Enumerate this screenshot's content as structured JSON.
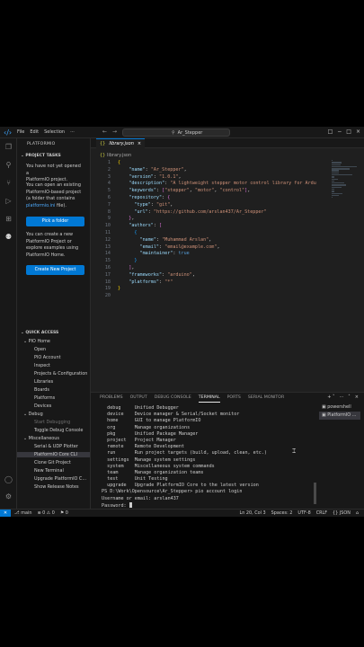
{
  "titlebar": {
    "menus": [
      "File",
      "Edit",
      "Selection",
      "···"
    ],
    "search": "Ar_Stepper",
    "controls": [
      "□",
      "−",
      "□",
      "×"
    ]
  },
  "sidebar": {
    "title": "PLATFORMIO",
    "project_tasks": "PROJECT TASKS",
    "intro_lines": [
      "You have not yet opened a",
      "PlatformIO project."
    ],
    "open_lines": [
      "You can open an existing",
      "PlatformIO-based project",
      "(a folder that contains"
    ],
    "open_link": "platformio.ini",
    "open_link_suffix": " file).",
    "pick_folder_button": "Pick a folder",
    "create_lines": [
      "You can create a new",
      "PlatformIO Project or",
      "explore examples using",
      "PlatformIO Home."
    ],
    "create_project_button": "Create New Project",
    "quick_access": "QUICK ACCESS",
    "pio_home": "PIO Home",
    "pio_home_items": [
      "Open",
      "PIO Account",
      "Inspect",
      "Projects & Configuration",
      "Libraries",
      "Boards",
      "Platforms",
      "Devices"
    ],
    "debug": "Debug",
    "debug_items": [
      "Start Debugging",
      "Toggle Debug Console"
    ],
    "misc": "Miscellaneous",
    "misc_items": [
      "Serial & UDP Plotter",
      "PlatformIO Core CLI",
      "Clone Git Project",
      "New Terminal",
      "Upgrade PlatformIO C...",
      "Show Release Notes"
    ]
  },
  "editor": {
    "tab_label": "library.json",
    "tab_icon": "{}",
    "breadcrumb": "library.json",
    "lines": [
      {
        "n": "1",
        "parts": [
          [
            "br1",
            "{"
          ]
        ]
      },
      {
        "n": "2",
        "parts": [
          [
            "key",
            "    \"name\""
          ],
          [
            "pun",
            ": "
          ],
          [
            "str",
            "\"Ar_Stepper\""
          ],
          [
            "pun",
            ","
          ]
        ]
      },
      {
        "n": "3",
        "parts": [
          [
            "key",
            "    \"version\""
          ],
          [
            "pun",
            ": "
          ],
          [
            "str",
            "\"1.0.1\""
          ],
          [
            "pun",
            ","
          ]
        ]
      },
      {
        "n": "4",
        "parts": [
          [
            "key",
            "    \"description\""
          ],
          [
            "pun",
            ": "
          ],
          [
            "str",
            "\"A lightweight stepper motor control library for Ardu"
          ]
        ]
      },
      {
        "n": "5",
        "parts": [
          [
            "key",
            "    \"keywords\""
          ],
          [
            "pun",
            ": "
          ],
          [
            "br2",
            "["
          ],
          [
            "str",
            "\"stepper\""
          ],
          [
            "pun",
            ", "
          ],
          [
            "str",
            "\"motor\""
          ],
          [
            "pun",
            ", "
          ],
          [
            "str",
            "\"control\""
          ],
          [
            "br2",
            "]"
          ],
          [
            "pun",
            ","
          ]
        ]
      },
      {
        "n": "6",
        "parts": [
          [
            "key",
            "    \"repository\""
          ],
          [
            "pun",
            ": "
          ],
          [
            "br2",
            "{"
          ]
        ]
      },
      {
        "n": "7",
        "parts": [
          [
            "key",
            "      \"type\""
          ],
          [
            "pun",
            ": "
          ],
          [
            "str",
            "\"git\""
          ],
          [
            "pun",
            ","
          ]
        ]
      },
      {
        "n": "8",
        "parts": [
          [
            "key",
            "      \"url\""
          ],
          [
            "pun",
            ": "
          ],
          [
            "str",
            "\"https://github.com/arslan437/Ar_Stepper\""
          ]
        ]
      },
      {
        "n": "9",
        "parts": [
          [
            "br2",
            "    }"
          ],
          [
            "pun",
            ","
          ]
        ]
      },
      {
        "n": "10",
        "parts": [
          [
            "key",
            "    \"authors\""
          ],
          [
            "pun",
            ": "
          ],
          [
            "br2",
            "["
          ]
        ]
      },
      {
        "n": "11",
        "parts": [
          [
            "br3",
            "      {"
          ]
        ]
      },
      {
        "n": "12",
        "parts": [
          [
            "key",
            "        \"name\""
          ],
          [
            "pun",
            ": "
          ],
          [
            "str",
            "\"Muhammad Arslan\""
          ],
          [
            "pun",
            ","
          ]
        ]
      },
      {
        "n": "13",
        "parts": [
          [
            "key",
            "        \"email\""
          ],
          [
            "pun",
            ": "
          ],
          [
            "str",
            "\"email@example.com\""
          ],
          [
            "pun",
            ","
          ]
        ]
      },
      {
        "n": "14",
        "parts": [
          [
            "key",
            "        \"maintainer\""
          ],
          [
            "pun",
            ": "
          ],
          [
            "bool",
            "true"
          ]
        ]
      },
      {
        "n": "15",
        "parts": [
          [
            "br3",
            "      }"
          ]
        ]
      },
      {
        "n": "16",
        "parts": [
          [
            "br2",
            "    ]"
          ],
          [
            "pun",
            ","
          ]
        ]
      },
      {
        "n": "17",
        "parts": [
          [
            "key",
            "    \"frameworks\""
          ],
          [
            "pun",
            ": "
          ],
          [
            "str",
            "\"arduino\""
          ],
          [
            "pun",
            ","
          ]
        ]
      },
      {
        "n": "18",
        "parts": [
          [
            "key",
            "    \"platforms\""
          ],
          [
            "pun",
            ": "
          ],
          [
            "str",
            "\"*\""
          ]
        ]
      },
      {
        "n": "19",
        "parts": [
          [
            "br1",
            "}"
          ]
        ]
      },
      {
        "n": "20",
        "parts": []
      }
    ]
  },
  "panel": {
    "tabs": [
      "PROBLEMS",
      "OUTPUT",
      "DEBUG CONSOLE",
      "TERMINAL",
      "PORTS",
      "SERIAL MONITOR"
    ],
    "active_tab": "TERMINAL",
    "controls": [
      "+ ˅",
      "···",
      "˄",
      "×"
    ],
    "terminal_lines": [
      "  debug     Unified Debugger",
      "  device    Device manager & Serial/Socket monitor",
      "  home      GUI to manage PlatformIO",
      "  org       Manage organizations",
      "  pkg       Unified Package Manager",
      "  project   Project Manager",
      "  remote    Remote Development",
      "  run       Run project targets (build, upload, clean, etc.)",
      "  settings  Manage system settings",
      "  system    Miscellaneous system commands",
      "  team      Manage organization teams",
      "  test      Unit Testing",
      "  upgrade   Upgrade PlatformIO Core to the latest version",
      "PS D:\\Work\\Opensource\\Ar_Stepper> pio account login",
      "Username or email: arslan437"
    ],
    "password_prompt": "Password: ",
    "terminals": [
      "powershell",
      "PlatformIO ..."
    ]
  },
  "status": {
    "remote": "✕",
    "branch": "main",
    "problems": "⊗ 0 ⚠ 0",
    "ports": "⚑ 0",
    "position": "Ln 20, Col 3",
    "spaces": "Spaces: 2",
    "encoding": "UTF-8",
    "eol": "CRLF",
    "language": "{} JSON",
    "bell": "⌂"
  }
}
